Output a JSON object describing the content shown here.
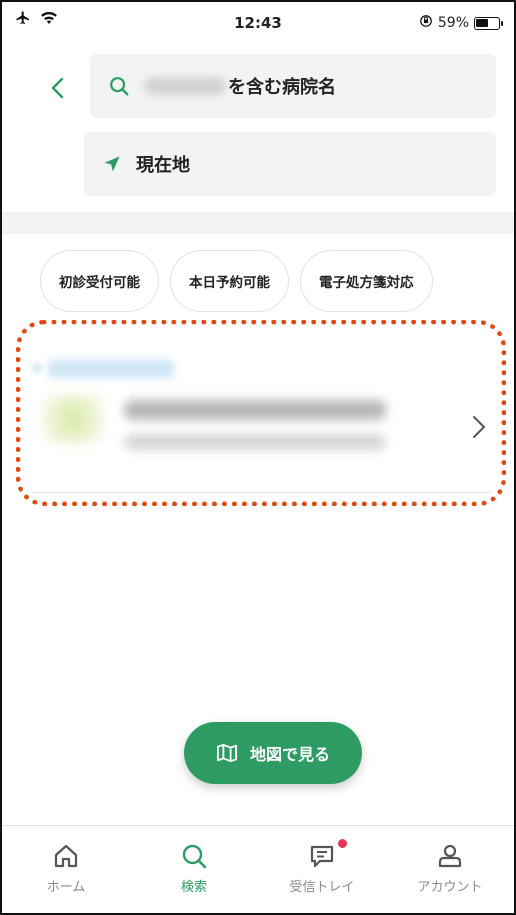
{
  "status_bar": {
    "time": "12:43",
    "battery_percent": "59%",
    "battery_level": 0.59,
    "icons": [
      "airplane-icon",
      "wifi-icon",
      "orientation-lock-icon",
      "battery-icon"
    ]
  },
  "header": {
    "search_query_suffix": "を含む病院名",
    "location_label": "現在地"
  },
  "filters": [
    {
      "label": "初診受付可能"
    },
    {
      "label": "本日予約可能"
    },
    {
      "label": "電子処方箋対応"
    }
  ],
  "colors": {
    "accent": "#2e9b63",
    "highlight_outline": "#e04a12",
    "notification": "#e8335a"
  },
  "map_button": {
    "label": "地図で見る"
  },
  "tab_bar": {
    "tabs": [
      {
        "label": "ホーム",
        "icon": "home-icon",
        "active": false
      },
      {
        "label": "検索",
        "icon": "search-icon",
        "active": true
      },
      {
        "label": "受信トレイ",
        "icon": "inbox-icon",
        "active": false,
        "badge": true
      },
      {
        "label": "アカウント",
        "icon": "account-icon",
        "active": false
      }
    ]
  }
}
